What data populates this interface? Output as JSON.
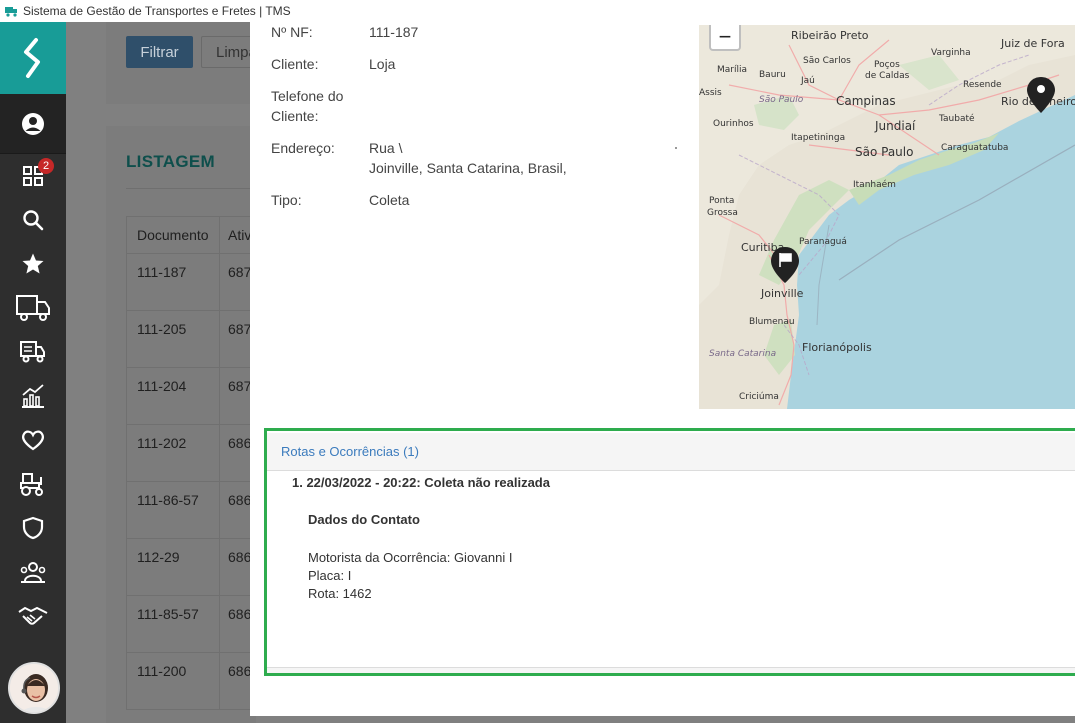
{
  "window": {
    "title": "Sistema de Gestão de Transportes e Fretes | TMS"
  },
  "sidebar": {
    "notification_count": "2",
    "items": [
      {
        "icon": "dashboard-icon"
      },
      {
        "icon": "search-icon"
      },
      {
        "icon": "star-icon"
      },
      {
        "icon": "truck-icon"
      },
      {
        "icon": "truck-list-icon"
      },
      {
        "icon": "chart-icon"
      },
      {
        "icon": "heart-icon"
      },
      {
        "icon": "tractor-icon"
      },
      {
        "icon": "shield-icon"
      },
      {
        "icon": "team-icon"
      },
      {
        "icon": "handshake-icon"
      }
    ]
  },
  "background": {
    "filter_button": "Filtrar",
    "clear_button": "Limpa",
    "listing_title": "LISTAGEM",
    "table": {
      "headers": [
        "Documento",
        "Ativ"
      ],
      "rows": [
        [
          "111-187",
          "687"
        ],
        [
          "111-205",
          "687"
        ],
        [
          "111-204",
          "687"
        ],
        [
          "111-202",
          "686"
        ],
        [
          "111-86-57",
          "686"
        ],
        [
          "112-29",
          "686"
        ],
        [
          "111-85-57",
          "686"
        ],
        [
          "111-200",
          "686"
        ]
      ]
    }
  },
  "details": {
    "nf": {
      "label": "Nº NF:",
      "value": "111-187"
    },
    "client": {
      "label": "Cliente:",
      "value": "Loja"
    },
    "phone": {
      "label": "Telefone do Cliente:",
      "value": ""
    },
    "address": {
      "label": "Endereço:",
      "line1": "Rua \\",
      "line2": "Joinville, Santa Catarina, Brasil,"
    },
    "type": {
      "label": "Tipo:",
      "value": "Coleta"
    }
  },
  "map": {
    "zoom_out": "−",
    "labels": {
      "ribeirao_preto": "Ribeirão Preto",
      "juiz_de_fora": "Juiz de Fora",
      "marilia": "Marília",
      "bauru": "Bauru",
      "sao_carlos": "São Carlos",
      "pocos": "Poços",
      "de_caldas": "de Caldas",
      "varginha": "Varginha",
      "jau": "Jaú",
      "assis": "Assis",
      "sao_paulo_state": "São Paulo",
      "campinas": "Campinas",
      "resende": "Resende",
      "rio_de_janeiro": "Rio de Janeiro",
      "ourinhos": "Ourinhos",
      "jundiai": "Jundiaí",
      "taubate": "Taubaté",
      "itapetininga": "Itapetininga",
      "sao_paulo": "São Paulo",
      "caraguatatuba": "Caraguatatuba",
      "itanhaem": "Itanhaém",
      "ponta": "Ponta",
      "grossa": "Grossa",
      "curitiba": "Curitiba",
      "paranagua": "Paranaguá",
      "joinville": "Joinville",
      "blumenau": "Blumenau",
      "santa_catarina": "Santa Catarina",
      "florianopolis": "Florianópolis",
      "criciuma": "Criciúma"
    }
  },
  "occurrences": {
    "header": "Rotas e Ocorrências (1)",
    "entry": "1. 22/03/2022 - 20:22: Coleta não realizada",
    "contact_title": "Dados do Contato",
    "driver": "Motorista da Ocorrência: Giovanni I",
    "plate": "Placa: I",
    "route": "Rota: 1462"
  }
}
